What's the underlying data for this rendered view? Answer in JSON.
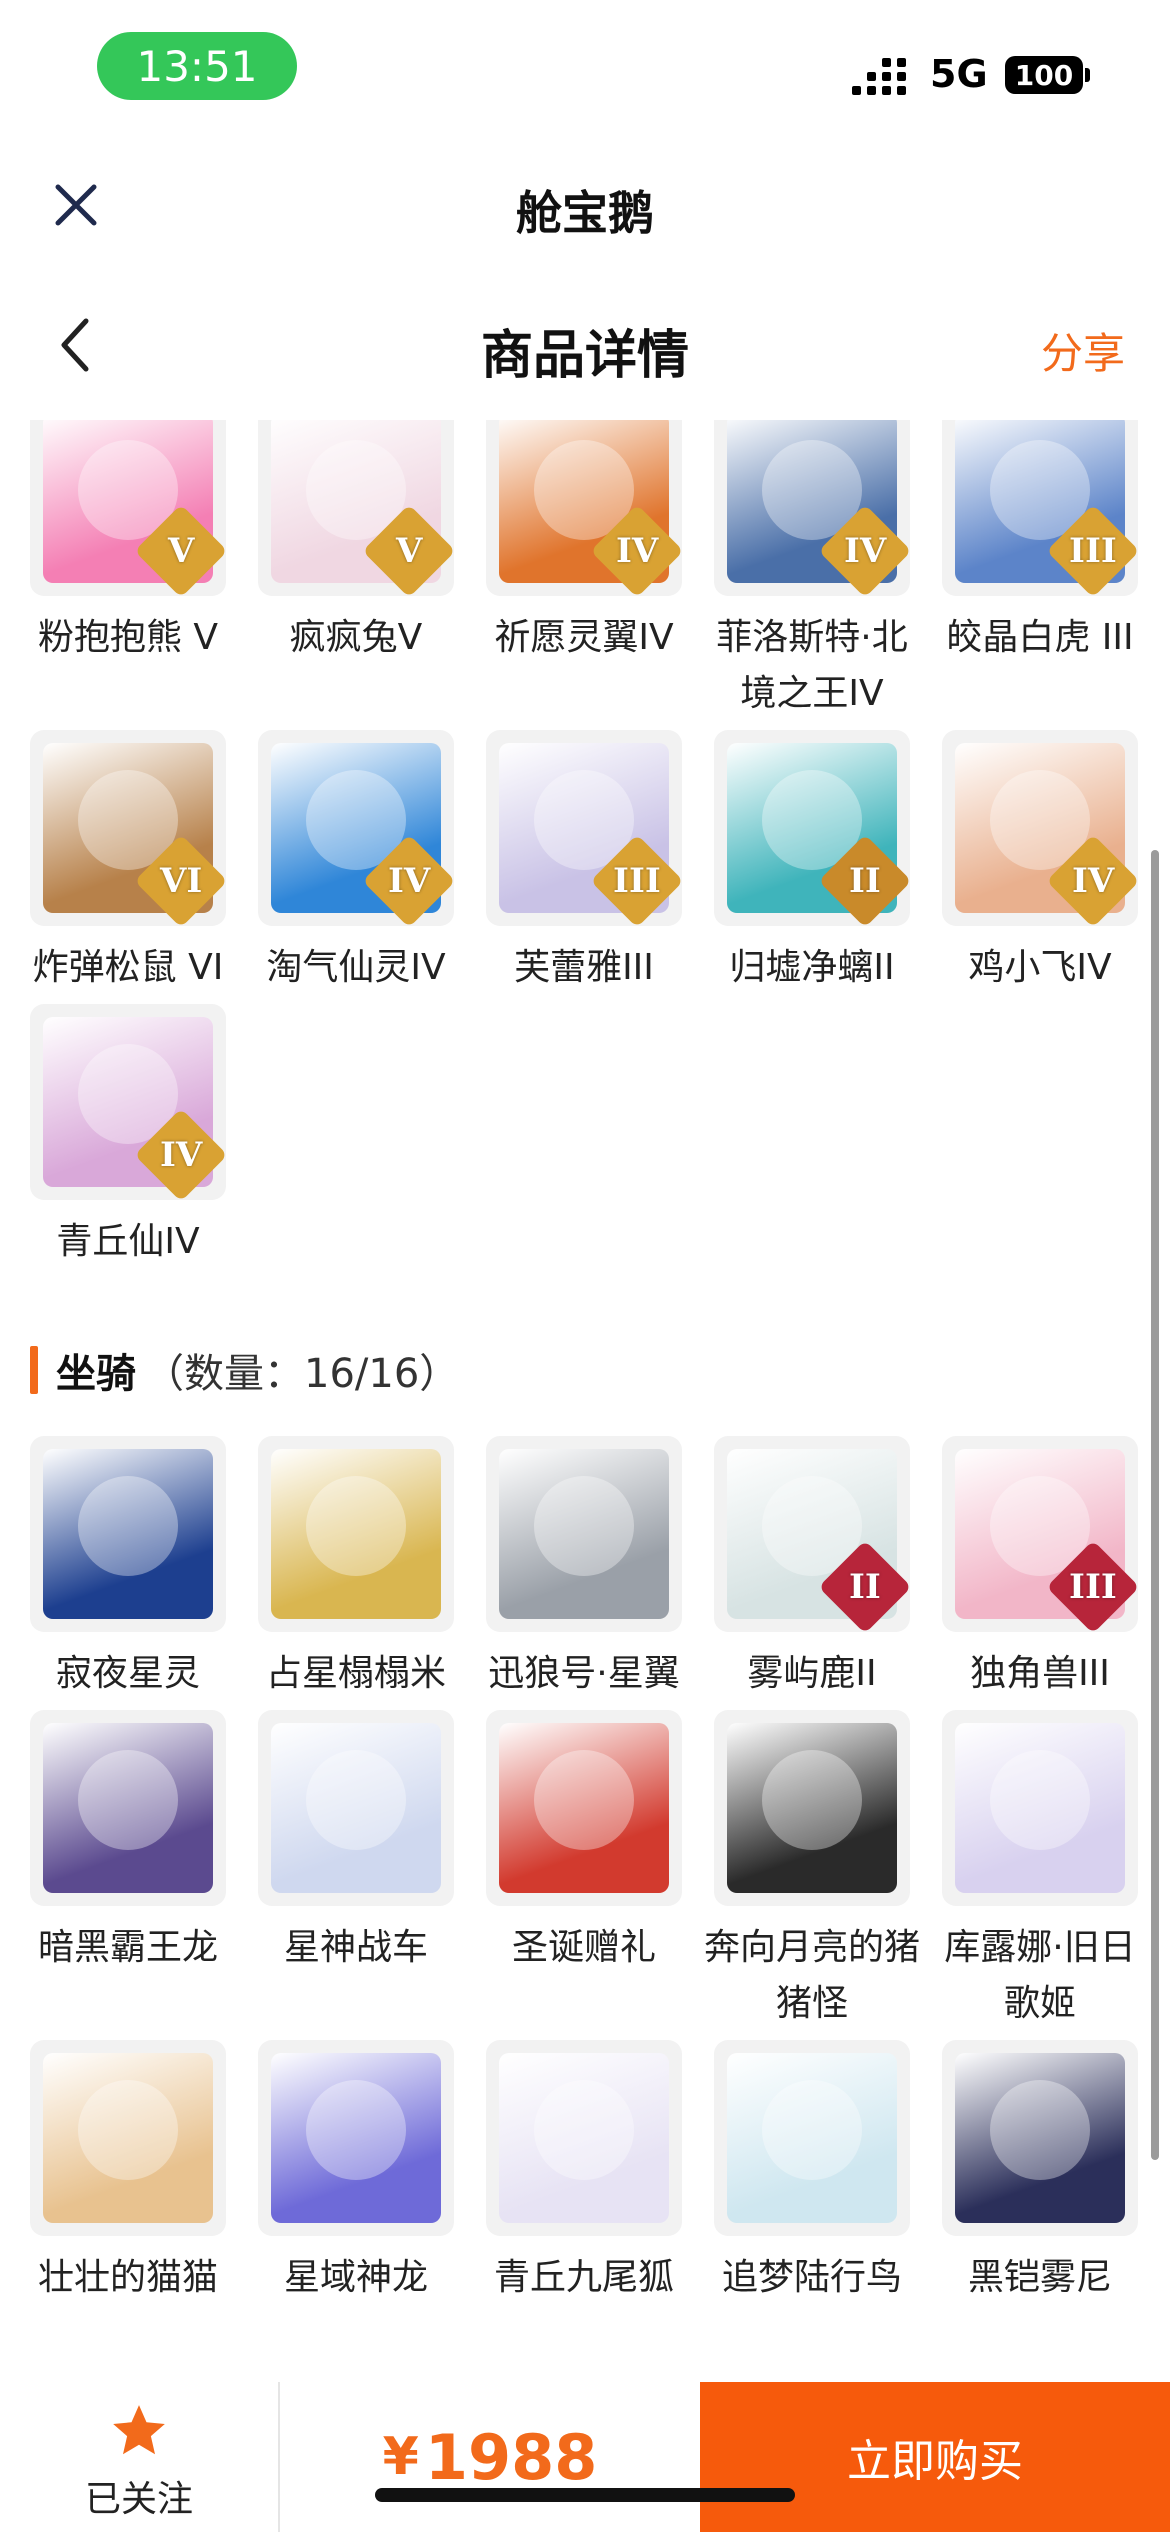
{
  "status": {
    "time": "13:51",
    "network": "5G",
    "battery": "100"
  },
  "header": {
    "app_title": "舱宝鹅",
    "page_title": "商品详情",
    "share_label": "分享"
  },
  "pets": [
    {
      "label": "粉抱抱熊 V",
      "badge": "V",
      "color": "#f47fb4",
      "badge_color": "#d9a233"
    },
    {
      "label": "疯疯兔V",
      "badge": "V",
      "color": "#f0d7e2",
      "badge_color": "#d9a233"
    },
    {
      "label": "祈愿灵翼IV",
      "badge": "IV",
      "color": "#e0742c",
      "badge_color": "#d9a233"
    },
    {
      "label": "菲洛斯特·北境之王IV",
      "badge": "IV",
      "color": "#4a6fa8",
      "badge_color": "#d9a233"
    },
    {
      "label": "皎晶白虎 III",
      "badge": "III",
      "color": "#5c84c9",
      "badge_color": "#d9a233"
    },
    {
      "label": "炸弹松鼠 VI",
      "badge": "VI",
      "color": "#b7814a",
      "badge_color": "#d9a233"
    },
    {
      "label": "淘气仙灵IV",
      "badge": "IV",
      "color": "#2f86d8",
      "badge_color": "#d9a233"
    },
    {
      "label": "芙蕾雅III",
      "badge": "III",
      "color": "#c9c2e6",
      "badge_color": "#d9a233"
    },
    {
      "label": "归墟净螭II",
      "badge": "II",
      "color": "#3fb4bb",
      "badge_color": "#c98a2a"
    },
    {
      "label": "鸡小飞IV",
      "badge": "IV",
      "color": "#e9b08e",
      "badge_color": "#d9a233"
    },
    {
      "label": "青丘仙IV",
      "badge": "IV",
      "color": "#d9a8d9",
      "badge_color": "#d9a233"
    }
  ],
  "mounts_section": {
    "title": "坐骑",
    "count": "（数量：16/16）"
  },
  "mounts": [
    {
      "label": "寂夜星灵",
      "badge": "",
      "color": "#1d3f8f",
      "badge_color": ""
    },
    {
      "label": "占星榻榻米",
      "badge": "",
      "color": "#d9b650",
      "badge_color": ""
    },
    {
      "label": "迅狼号·星翼",
      "badge": "",
      "color": "#9aa0a8",
      "badge_color": ""
    },
    {
      "label": "雾屿鹿II",
      "badge": "II",
      "color": "#d7e3e3",
      "badge_color": "#b7253a"
    },
    {
      "label": "独角兽III",
      "badge": "III",
      "color": "#f2b6c8",
      "badge_color": "#b7253a"
    },
    {
      "label": "暗黑霸王龙",
      "badge": "",
      "color": "#5b4a8f",
      "badge_color": ""
    },
    {
      "label": "星神战车",
      "badge": "",
      "color": "#cfd8ef",
      "badge_color": ""
    },
    {
      "label": "圣诞赠礼",
      "badge": "",
      "color": "#d23a2e",
      "badge_color": ""
    },
    {
      "label": "奔向月亮的猪猪怪",
      "badge": "",
      "color": "#2a2a2a",
      "badge_color": ""
    },
    {
      "label": "库露娜·旧日歌姬",
      "badge": "",
      "color": "#d8d1ef",
      "badge_color": ""
    },
    {
      "label": "壮壮的猫猫",
      "badge": "",
      "color": "#e8c28f",
      "badge_color": ""
    },
    {
      "label": "星域神龙",
      "badge": "",
      "color": "#6e6ad8",
      "badge_color": ""
    },
    {
      "label": "青丘九尾狐",
      "badge": "",
      "color": "#e7e3f4",
      "badge_color": ""
    },
    {
      "label": "追梦陆行鸟",
      "badge": "",
      "color": "#cfe7f0",
      "badge_color": ""
    },
    {
      "label": "黑铠雾尼",
      "badge": "",
      "color": "#2b2f5a",
      "badge_color": ""
    }
  ],
  "bottom": {
    "follow_label": "已关注",
    "currency": "¥",
    "price": "1988",
    "buy_label": "立即购买"
  },
  "colors": {
    "accent": "#f26a1b",
    "buy": "#f65a0c",
    "time_pill": "#34c759"
  }
}
